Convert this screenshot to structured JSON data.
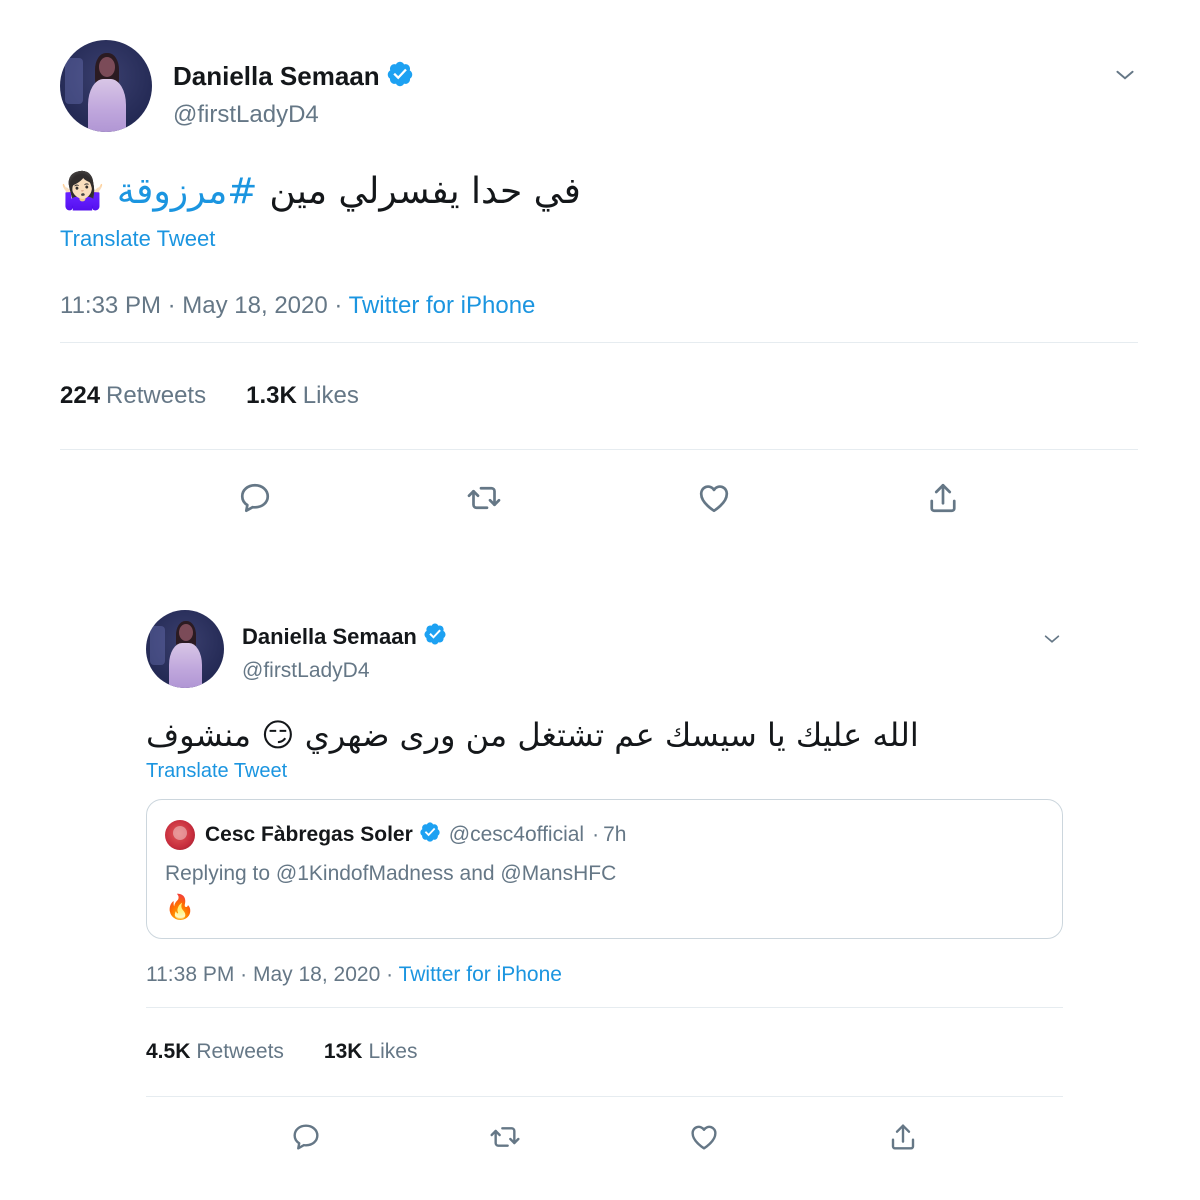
{
  "tweet1": {
    "display_name": "Daniella Semaan",
    "handle": "@firstLadyD4",
    "text_before_hashtag": "في حدا يفسرلي مين",
    "hashtag": "#مرزوقة",
    "emoji": "🤷🏻‍♀️",
    "translate_label": "Translate Tweet",
    "time": "11:33 PM",
    "date": "May 18, 2020",
    "source": "Twitter for iPhone",
    "retweets_count": "224",
    "retweets_label": "Retweets",
    "likes_count": "1.3K",
    "likes_label": "Likes"
  },
  "tweet2": {
    "display_name": "Daniella Semaan",
    "handle": "@firstLadyD4",
    "text": "الله عليك يا سيسك عم تشتغل من ورى ضهري 😏 منشوف",
    "translate_label": "Translate Tweet",
    "quoted": {
      "display_name": "Cesc Fàbregas Soler",
      "handle": "@cesc4official",
      "age": "7h",
      "replying_prefix": "Replying to",
      "reply_user1": "@1KindofMadness",
      "reply_and": "and",
      "reply_user2": "@MansHFC",
      "emoji": "🔥"
    },
    "time": "11:38 PM",
    "date": "May 18, 2020",
    "source": "Twitter for iPhone",
    "retweets_count": "4.5K",
    "retweets_label": "Retweets",
    "likes_count": "13K",
    "likes_label": "Likes"
  },
  "colors": {
    "link": "#1b95e0",
    "secondary_text": "#657786",
    "primary_text": "#14171a",
    "divider": "#e6ecf0"
  },
  "icons": [
    "verified-badge-icon",
    "chevron-down-icon",
    "reply-icon",
    "retweet-icon",
    "like-icon",
    "share-icon"
  ]
}
